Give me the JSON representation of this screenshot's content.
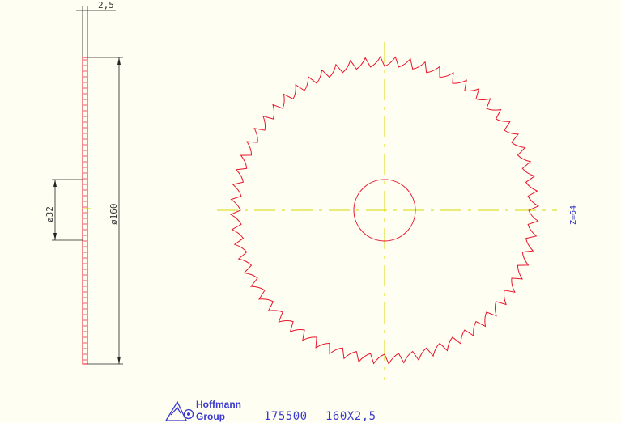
{
  "dimensions": {
    "thickness": "2,5",
    "hub_diameter": "ø32",
    "outer_diameter": "ø160"
  },
  "blade": {
    "teeth_count": 64,
    "teeth_label": "Z=64"
  },
  "title_block": {
    "brand_line1": "Hoffmann",
    "brand_line2": "Group",
    "part_number": "175500",
    "size": "160X2,5"
  },
  "colors": {
    "background": "#fefef2",
    "outline": "#e8142a",
    "centerline": "#d8d800",
    "dimension": "#222222",
    "annotation": "#3a3ad0"
  }
}
